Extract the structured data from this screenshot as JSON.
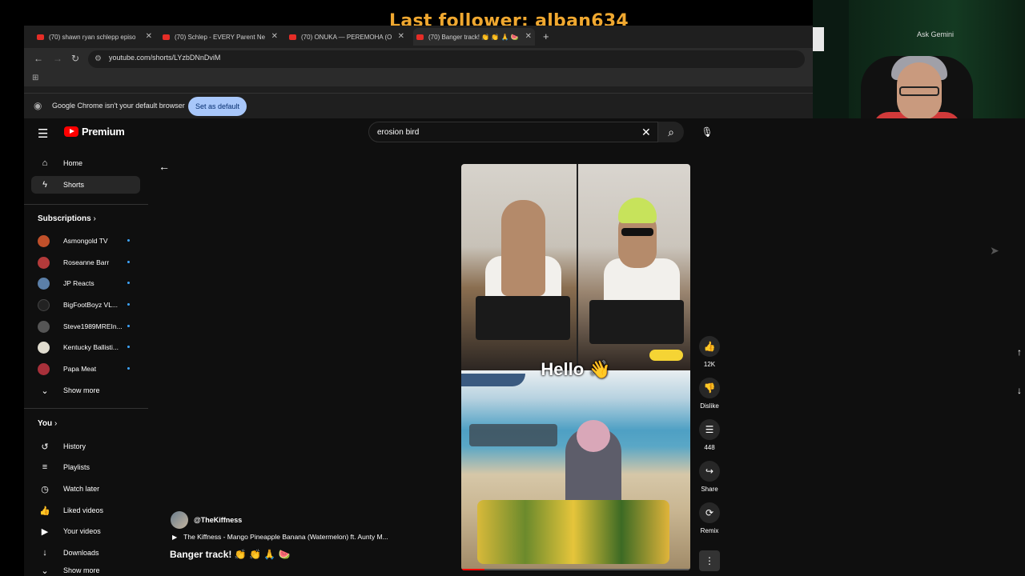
{
  "overlay": {
    "last_follower": "Last follower: alban634"
  },
  "browser": {
    "tabs": [
      {
        "label": "(70) shawn ryan schlepp episo"
      },
      {
        "label": "(70) Schlep - EVERY Parent Ne"
      },
      {
        "label": "(70) ONUKA — PEREMOHA (O"
      },
      {
        "label": "(70) Banger track! 👏 👏 🙏 🍉"
      }
    ],
    "url": "youtube.com/shorts/LYzbDNnDviM",
    "infobar_text": "Google Chrome isn't your default browser",
    "infobar_button": "Set as default",
    "ask_gemini": "Ask Gemini"
  },
  "youtube": {
    "logo": "Premium",
    "search_value": "erosion bird",
    "nav": [
      {
        "label": "Home",
        "icon": "home-icon"
      },
      {
        "label": "Shorts",
        "icon": "shorts-icon"
      }
    ],
    "subscriptions_title": "Subscriptions",
    "subscriptions": [
      {
        "name": "Asmongold TV",
        "color": "#c0502a"
      },
      {
        "name": "Roseanne Barr",
        "color": "#b33a3a"
      },
      {
        "name": "JP Reacts",
        "color": "#5b7fa8"
      },
      {
        "name": "BigFootBoyz VL...",
        "color": "#222222"
      },
      {
        "name": "Steve1989MREIn...",
        "color": "#555555"
      },
      {
        "name": "Kentucky Ballisti...",
        "color": "#e0dccf"
      },
      {
        "name": "Papa Meat",
        "color": "#a8303a"
      }
    ],
    "show_more": "Show more",
    "you_title": "You",
    "you_items": [
      {
        "label": "History",
        "icon": "history-icon"
      },
      {
        "label": "Playlists",
        "icon": "playlists-icon"
      },
      {
        "label": "Watch later",
        "icon": "clock-icon"
      },
      {
        "label": "Liked videos",
        "icon": "thumbs-up-icon"
      },
      {
        "label": "Your videos",
        "icon": "video-icon"
      },
      {
        "label": "Downloads",
        "icon": "download-icon"
      }
    ],
    "show_more_bottom": "Show more",
    "short": {
      "overlay_text": "Hello 👋",
      "channel": "@TheKiffness",
      "music": "The Kiffness - Mango Pineapple Banana (Watermelon) ft. Aunty M...",
      "title": "Banger track! 👏 👏 🙏 🍉",
      "progress": 0.1
    },
    "actions": [
      {
        "label": "12K",
        "icon": "like-icon"
      },
      {
        "label": "Dislike",
        "icon": "dislike-icon"
      },
      {
        "label": "448",
        "icon": "comment-icon"
      },
      {
        "label": "Share",
        "icon": "share-icon"
      },
      {
        "label": "Remix",
        "icon": "remix-icon"
      }
    ]
  }
}
